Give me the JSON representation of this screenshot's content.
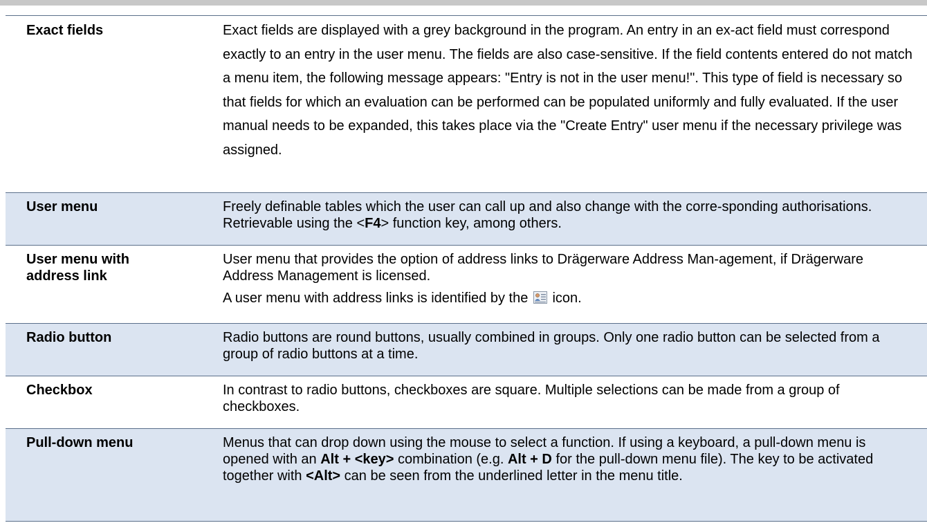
{
  "rows": [
    {
      "term": "Exact fields",
      "definition": "Exact fields are displayed with a grey background in the program. An entry in an ex-act field must correspond exactly to an entry in the user menu. The fields are also case-sensitive. If the field contents entered do not match a menu item, the following message appears: \"Entry is not in the user menu!\". This type of field is necessary so that fields for which an evaluation can be performed can be populated uniformly and fully evaluated. If the user manual needs to be expanded, this takes place via the \"Create Entry\" user menu if the necessary privilege was assigned."
    },
    {
      "term": "User menu",
      "definition_pre": "Freely definable tables which the user can call up and also change with the corre-sponding authorisations. Retrievable using the <",
      "key": "F4",
      "definition_post": "> function key, among others."
    },
    {
      "term_line1": "User menu with",
      "term_line2": "address link",
      "definition": "User menu that provides the option of address links to Drägerware Address Man-agement, if Drägerware Address Management is licensed.",
      "definition2_pre": "A user menu with address links is identified by the",
      "definition2_post": "icon.",
      "icon": "address-link-icon"
    },
    {
      "term": "Radio button",
      "definition": "Radio buttons are round buttons, usually combined in groups. Only one radio button can be selected from a group of radio buttons at a time."
    },
    {
      "term": "Checkbox",
      "definition": "In contrast to radio buttons, checkboxes are square. Multiple selections can be made from a group of checkboxes."
    },
    {
      "term": "Pull-down menu",
      "def_a": "Menus that can drop down using the mouse to select a function. If using a keyboard, a pull-down menu is opened with an",
      "bold_a": "Alt + <key>",
      "def_b": "combination (e.g.",
      "bold_b": "Alt + D",
      "def_c": "for the pull-down menu file). The key to be activated together with",
      "bold_c": "<Alt>",
      "def_d": "can be seen from the underlined letter in the menu title."
    }
  ],
  "colors": {
    "shade": "#dbe4f1",
    "border": "#5a6f8a",
    "top_bar": "#c8c8c8"
  }
}
